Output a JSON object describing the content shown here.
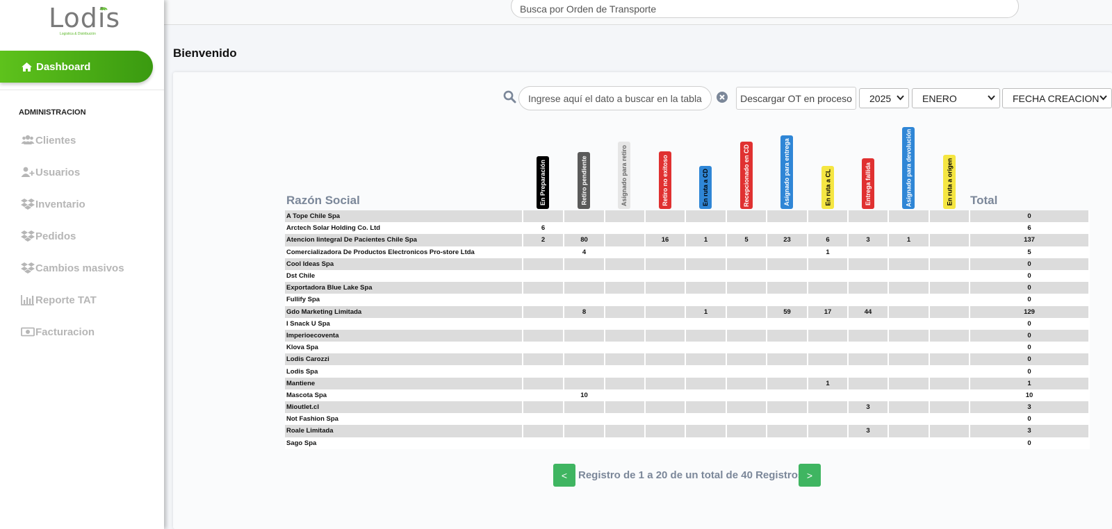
{
  "brand": {
    "name": "Lodis",
    "tagline": "Logistica & Distribución"
  },
  "top_search": {
    "placeholder": "Busca por Orden de Transporte"
  },
  "sidebar": {
    "dashboard": "Dashboard",
    "section": "ADMINISTRACION",
    "items": [
      {
        "label": "Clientes",
        "icon": "users-icon"
      },
      {
        "label": "Usuarios",
        "icon": "user-plus-icon"
      },
      {
        "label": "Inventario",
        "icon": "dropbox-icon"
      },
      {
        "label": "Pedidos",
        "icon": "dropbox-icon"
      },
      {
        "label": "Cambios masivos",
        "icon": "dropbox-icon"
      },
      {
        "label": "Reporte TAT",
        "icon": "bar-chart-icon"
      },
      {
        "label": "Facturacion",
        "icon": "money-icon"
      }
    ]
  },
  "welcome": "Bienvenido",
  "controls": {
    "table_search_placeholder": "Ingrese aquí el dato a buscar en la tabla",
    "download_label": "Descargar OT en proceso",
    "year": "2025",
    "month": "ENERO",
    "date_type": "FECHA CREACION"
  },
  "table": {
    "name_header": "Razón Social",
    "total_header": "Total",
    "status_columns": [
      {
        "label": "En Preparación",
        "bg": "#000000",
        "fg": "#ffffff"
      },
      {
        "label": "Retiro pendiente",
        "bg": "#5a5a5a",
        "fg": "#ffffff"
      },
      {
        "label": "Asignado para retiro",
        "bg": "#e6e6e6",
        "fg": "#666666"
      },
      {
        "label": "Retiro no exitoso",
        "bg": "#e03131",
        "fg": "#ffffff"
      },
      {
        "label": "En ruta a CD",
        "bg": "#2f86d6",
        "fg": "#000000"
      },
      {
        "label": "Recepcionado en CD",
        "bg": "#e03131",
        "fg": "#ffffff"
      },
      {
        "label": "Asignado para entrega",
        "bg": "#2f86d6",
        "fg": "#ffffff"
      },
      {
        "label": "En ruta a CL",
        "bg": "#f5e642",
        "fg": "#000000"
      },
      {
        "label": "Entrega fallida",
        "bg": "#e03131",
        "fg": "#ffffff"
      },
      {
        "label": "Asignado para devolución",
        "bg": "#2f86d6",
        "fg": "#ffffff"
      },
      {
        "label": "En ruta a origen",
        "bg": "#f5e642",
        "fg": "#000000"
      }
    ],
    "rows": [
      {
        "name": "A Tope Chile Spa",
        "cells": [
          "",
          "",
          "",
          "",
          "",
          "",
          "",
          "",
          "",
          "",
          ""
        ],
        "total": "0"
      },
      {
        "name": "Arctech Solar Holding Co. Ltd",
        "cells": [
          "6",
          "",
          "",
          "",
          "",
          "",
          "",
          "",
          "",
          "",
          ""
        ],
        "total": "6"
      },
      {
        "name": "Atencion Iintegral De Pacientes Chile Spa",
        "cells": [
          "2",
          "80",
          "",
          "16",
          "1",
          "5",
          "23",
          "6",
          "3",
          "1",
          ""
        ],
        "total": "137"
      },
      {
        "name": "Comercializadora De Productos Electronicos Pro-store Ltda",
        "cells": [
          "",
          "4",
          "",
          "",
          "",
          "",
          "",
          "1",
          "",
          "",
          ""
        ],
        "total": "5"
      },
      {
        "name": "Cool Ideas Spa",
        "cells": [
          "",
          "",
          "",
          "",
          "",
          "",
          "",
          "",
          "",
          "",
          ""
        ],
        "total": "0"
      },
      {
        "name": "Dst Chile",
        "cells": [
          "",
          "",
          "",
          "",
          "",
          "",
          "",
          "",
          "",
          "",
          ""
        ],
        "total": "0"
      },
      {
        "name": "Exportadora Blue Lake Spa",
        "cells": [
          "",
          "",
          "",
          "",
          "",
          "",
          "",
          "",
          "",
          "",
          ""
        ],
        "total": "0"
      },
      {
        "name": "Fullify Spa",
        "cells": [
          "",
          "",
          "",
          "",
          "",
          "",
          "",
          "",
          "",
          "",
          ""
        ],
        "total": "0"
      },
      {
        "name": "Gdo Marketing Limitada",
        "cells": [
          "",
          "8",
          "",
          "",
          "1",
          "",
          "59",
          "17",
          "44",
          "",
          ""
        ],
        "total": "129"
      },
      {
        "name": "I Snack U Spa",
        "cells": [
          "",
          "",
          "",
          "",
          "",
          "",
          "",
          "",
          "",
          "",
          ""
        ],
        "total": "0"
      },
      {
        "name": "Imperioecoventa",
        "cells": [
          "",
          "",
          "",
          "",
          "",
          "",
          "",
          "",
          "",
          "",
          ""
        ],
        "total": "0"
      },
      {
        "name": "Klova Spa",
        "cells": [
          "",
          "",
          "",
          "",
          "",
          "",
          "",
          "",
          "",
          "",
          ""
        ],
        "total": "0"
      },
      {
        "name": "Lodis Carozzi",
        "cells": [
          "",
          "",
          "",
          "",
          "",
          "",
          "",
          "",
          "",
          "",
          ""
        ],
        "total": "0"
      },
      {
        "name": "Lodis Spa",
        "cells": [
          "",
          "",
          "",
          "",
          "",
          "",
          "",
          "",
          "",
          "",
          ""
        ],
        "total": "0"
      },
      {
        "name": "Mantiene",
        "cells": [
          "",
          "",
          "",
          "",
          "",
          "",
          "",
          "1",
          "",
          "",
          ""
        ],
        "total": "1"
      },
      {
        "name": "Mascota Spa",
        "cells": [
          "",
          "10",
          "",
          "",
          "",
          "",
          "",
          "",
          "",
          "",
          ""
        ],
        "total": "10"
      },
      {
        "name": "Mioutlet.cl",
        "cells": [
          "",
          "",
          "",
          "",
          "",
          "",
          "",
          "",
          "3",
          "",
          ""
        ],
        "total": "3"
      },
      {
        "name": "Not Fashion Spa",
        "cells": [
          "",
          "",
          "",
          "",
          "",
          "",
          "",
          "",
          "",
          "",
          ""
        ],
        "total": "0"
      },
      {
        "name": "Roale Limitada",
        "cells": [
          "",
          "",
          "",
          "",
          "",
          "",
          "",
          "",
          "3",
          "",
          ""
        ],
        "total": "3"
      },
      {
        "name": "Sago Spa",
        "cells": [
          "",
          "",
          "",
          "",
          "",
          "",
          "",
          "",
          "",
          "",
          ""
        ],
        "total": "0"
      }
    ]
  },
  "pagination": {
    "prev": "<",
    "next": ">",
    "text": "Registro de 1 a 20 de un total de 40 Registros"
  },
  "colors": {
    "accent_green": "#4caf1a",
    "pager_green": "#3fb561",
    "header_gray": "#7b8799"
  }
}
